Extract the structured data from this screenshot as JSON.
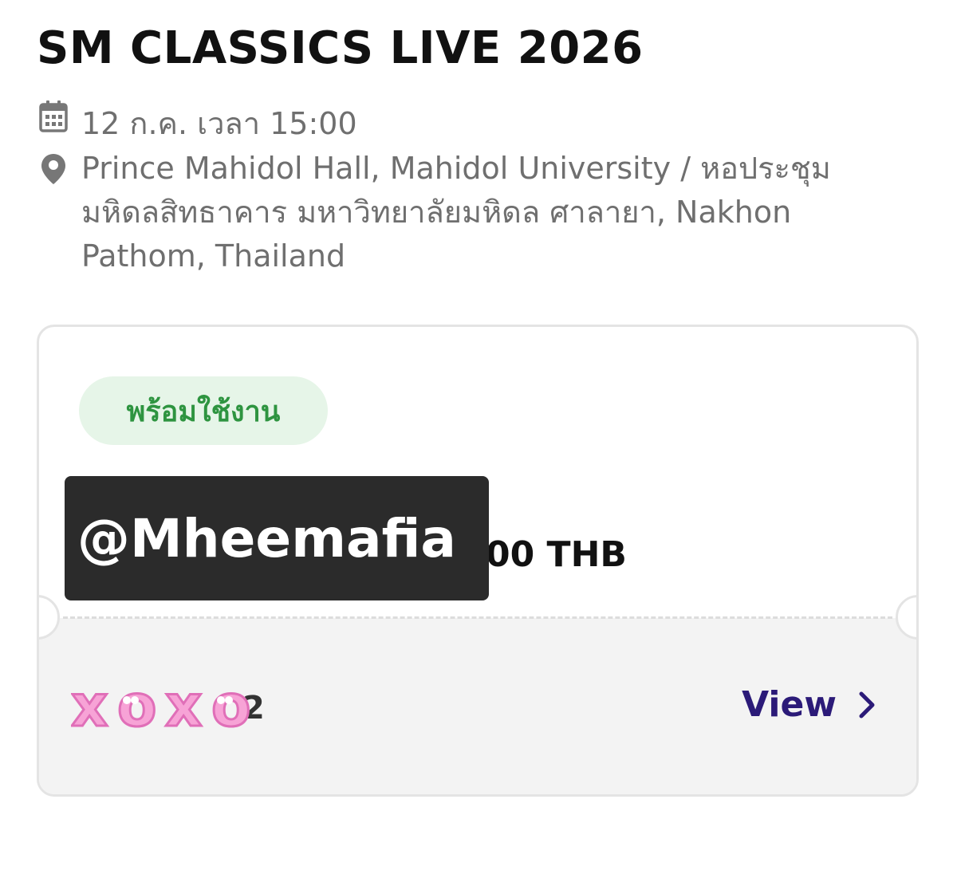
{
  "event": {
    "title": "SM CLASSICS LIVE 2026",
    "date_time": "12 ก.ค. เวลา 15:00",
    "venue": "Prince Mahidol Hall, Mahidol University / หอประชุมมหิดลสิทธาคาร มหาวิทยาลัยมหิดล ศาลายา, Nakhon Pathom, Thailand"
  },
  "ticket": {
    "status": "พร้อมใช้งาน",
    "price_partial": "00 THB",
    "watermark_text": "@Mheemafia",
    "seat_partial": "2",
    "sticker_text": "xoxo",
    "view_label": "View"
  },
  "colors": {
    "status_green": "#2e9440",
    "status_bg": "#e6f5e8",
    "view_purple": "#2b1a78",
    "sticker_pink": "#f7a3d6"
  },
  "icons": [
    "calendar-icon",
    "location-pin-icon",
    "chevron-right-icon"
  ]
}
